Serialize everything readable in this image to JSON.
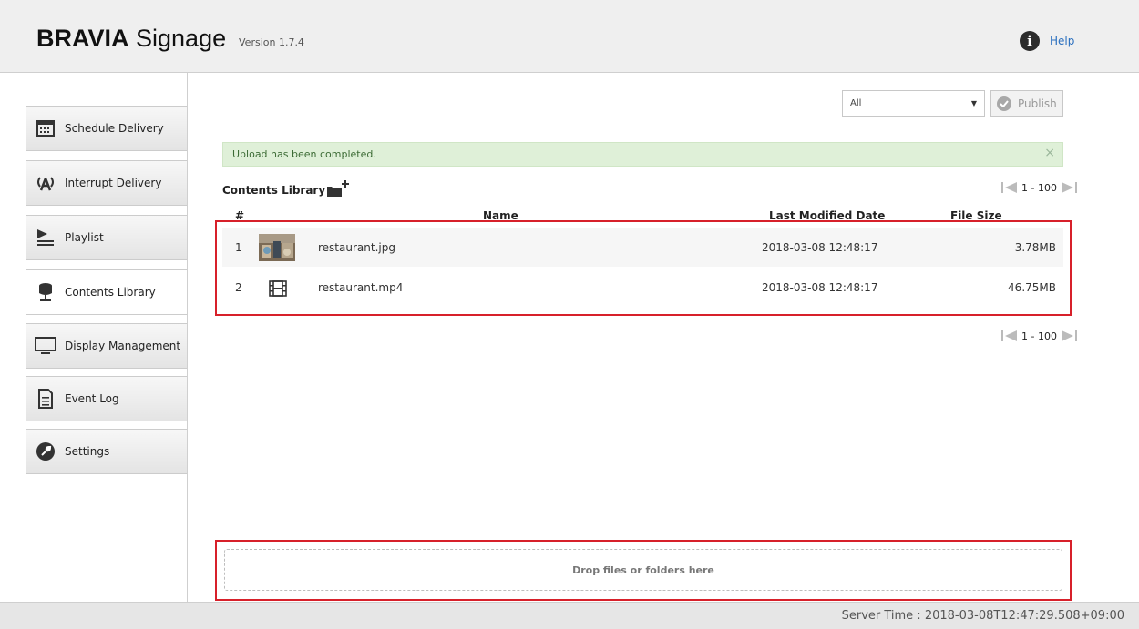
{
  "header": {
    "brand_strong": "BRAVIA",
    "brand_light": " Signage",
    "version": "Version 1.7.4",
    "help_label": "Help",
    "help_icon": "info-icon"
  },
  "sidebar": {
    "items": [
      {
        "label": "Schedule Delivery",
        "icon": "calendar-icon",
        "active": false
      },
      {
        "label": "Interrupt Delivery",
        "icon": "broadcast-icon",
        "active": false
      },
      {
        "label": "Playlist",
        "icon": "playlist-icon",
        "active": false
      },
      {
        "label": "Contents Library",
        "icon": "database-icon",
        "active": true
      },
      {
        "label": "Display Management",
        "icon": "monitor-icon",
        "active": false
      },
      {
        "label": "Event Log",
        "icon": "document-icon",
        "active": false
      },
      {
        "label": "Settings",
        "icon": "wrench-icon",
        "active": false
      }
    ]
  },
  "toolbar": {
    "filter_value": "All",
    "publish_label": "Publish"
  },
  "alert": {
    "message": "Upload has been completed.",
    "close": "×"
  },
  "library": {
    "title": "Contents Library",
    "pager_top": "1 - 100",
    "pager_bottom": "1 - 100",
    "columns": {
      "index": "#",
      "name": "Name",
      "modified": "Last Modified Date",
      "size": "File Size"
    },
    "rows": [
      {
        "index": "1",
        "thumb": "image-thumbnail",
        "name": "restaurant.jpg",
        "modified": "2018-03-08 12:48:17",
        "size": "3.78MB"
      },
      {
        "index": "2",
        "thumb": "film-icon",
        "name": "restaurant.mp4",
        "modified": "2018-03-08 12:48:17",
        "size": "46.75MB"
      }
    ]
  },
  "dropzone": {
    "label": "Drop files or folders here"
  },
  "footer": {
    "server_time": "Server Time : 2018-03-08T12:47:29.508+09:00"
  },
  "colors": {
    "accent_link": "#2a6fbf",
    "highlight": "#d7202a",
    "alert_bg": "#dff0d8"
  }
}
